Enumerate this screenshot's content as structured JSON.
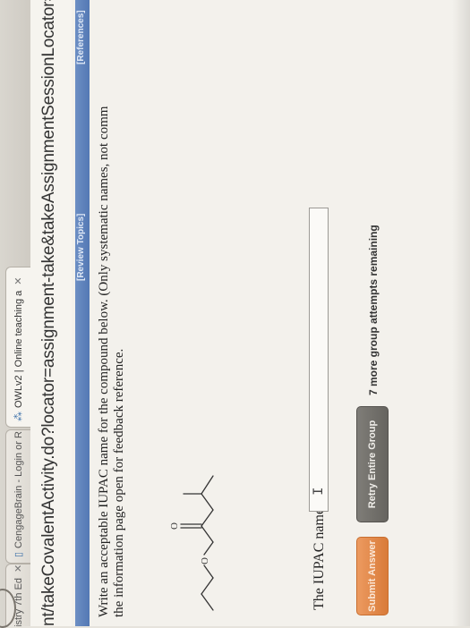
{
  "browser": {
    "tabs": [
      {
        "label": "istry 7th Ed",
        "icon": "page-icon"
      },
      {
        "label": "CengageBrain - Login or R",
        "icon": "document-icon"
      },
      {
        "label": "OWLv2 | Online teaching a",
        "icon": "owl-logo-icon"
      }
    ],
    "url": "nt/takeCovalentActivity.do?locator=assignment-take&takeAssignmentSessionLocator=assign"
  },
  "toolbar": {
    "review_topics": "[Review Topics]",
    "references": "[References]"
  },
  "question": {
    "line1": "Write an acceptable IUPAC name for the compound below. (Only systematic names, not comm",
    "line2": "the information page open for feedback reference."
  },
  "answer": {
    "label": "The IUPAC name is",
    "value": ""
  },
  "buttons": {
    "submit": "Submit Answer",
    "retry": "Retry Entire Group"
  },
  "status": {
    "attempts": "7 more group attempts remaining"
  },
  "colors": {
    "accent_blue": "#5f84bf",
    "submit_orange": "#e08744",
    "retry_gray": "#74726d"
  }
}
